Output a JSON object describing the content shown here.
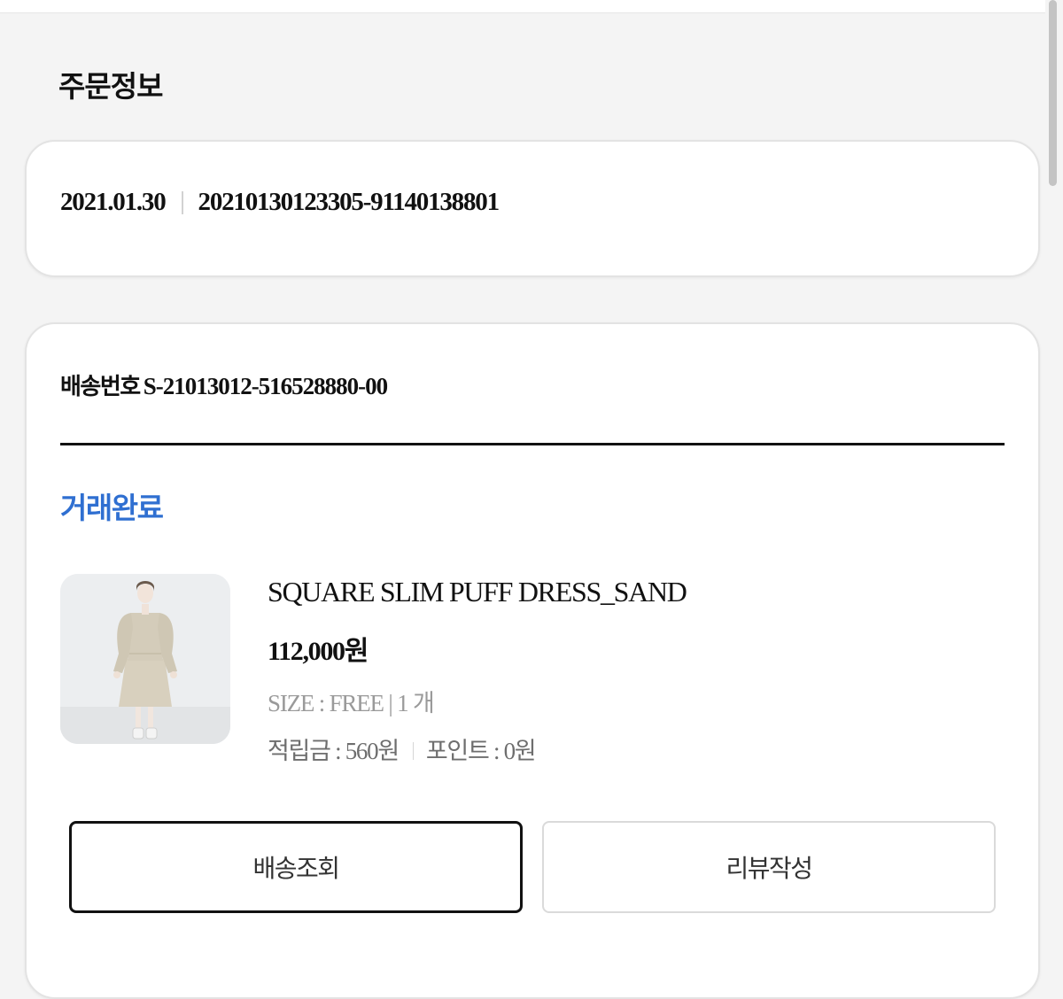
{
  "section": {
    "title": "주문정보"
  },
  "order": {
    "date": "2021.01.30",
    "number": "20210130123305-91140138801"
  },
  "delivery": {
    "label": "배송번호",
    "number": "S-21013012-516528880-00",
    "status": "거래완료",
    "status_color": "#2f6fd1"
  },
  "product": {
    "image_icon": "dress-photo",
    "name": "SQUARE SLIM PUFF DRESS_SAND",
    "price": "112,000원",
    "option": "SIZE : FREE | 1 개",
    "reward_points": "적립금 : 560원",
    "points": "포인트 : 0원"
  },
  "actions": {
    "track_label": "배송조회",
    "review_label": "리뷰작성"
  }
}
